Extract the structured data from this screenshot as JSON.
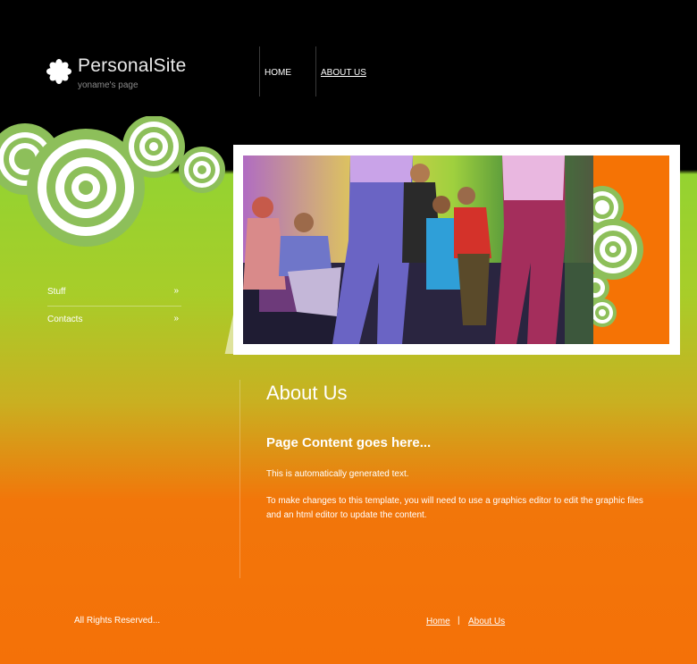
{
  "header": {
    "site_title": "PersonalSite",
    "site_subtitle": "yoname's page",
    "logo_icon": "asterisk-flower-icon",
    "nav": [
      {
        "label": "HOME"
      },
      {
        "label": "ABOUT US"
      }
    ]
  },
  "sidebar": {
    "items": [
      {
        "label": "Stuff",
        "arrow": "»"
      },
      {
        "label": "Contacts",
        "arrow": "»"
      }
    ]
  },
  "main": {
    "heading": "About Us",
    "subheading": "Page Content goes here...",
    "paragraphs": [
      "This is automatically generated text.",
      "To make changes to this template, you will need to use a graphics editor to edit the graphic files and an html editor to update the content."
    ]
  },
  "footer": {
    "copyright": "All Rights Reserved...",
    "links": [
      {
        "label": "Home"
      },
      {
        "label": "About Us"
      }
    ],
    "separator": "|"
  },
  "colors": {
    "header_bg": "#000000",
    "green": "#94d331",
    "orange": "#f47108",
    "circle_green": "#8dbf5a"
  }
}
